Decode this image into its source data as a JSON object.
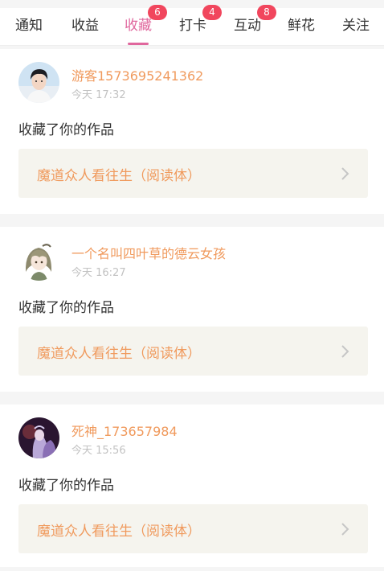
{
  "tabs": [
    {
      "label": "通知",
      "badge": ""
    },
    {
      "label": "收益",
      "badge": ""
    },
    {
      "label": "收藏",
      "badge": "6",
      "active": true
    },
    {
      "label": "打卡",
      "badge": "4"
    },
    {
      "label": "互动",
      "badge": "8"
    },
    {
      "label": "鲜花",
      "badge": ""
    },
    {
      "label": "关注",
      "badge": ""
    }
  ],
  "colors": {
    "accent_pink": "#e0679d",
    "name_orange": "#f09a5d",
    "badge_red": "#f1465d",
    "work_bg": "#f5f4ee"
  },
  "items": [
    {
      "avatar_icon": "user-avatar-boy",
      "username": "游客1573695241362",
      "time": "今天 17:32",
      "action": "收藏了你的作品",
      "work_title": "魔道众人看往生（阅读体）"
    },
    {
      "avatar_icon": "user-avatar-anime-girl",
      "username": "一个名叫四叶草的德云女孩",
      "time": "今天 16:27",
      "action": "收藏了你的作品",
      "work_title": "魔道众人看往生（阅读体）"
    },
    {
      "avatar_icon": "user-avatar-dark-anime",
      "username": "死神_173657984",
      "time": "今天 15:56",
      "action": "收藏了你的作品",
      "work_title": "魔道众人看往生（阅读体）"
    }
  ]
}
